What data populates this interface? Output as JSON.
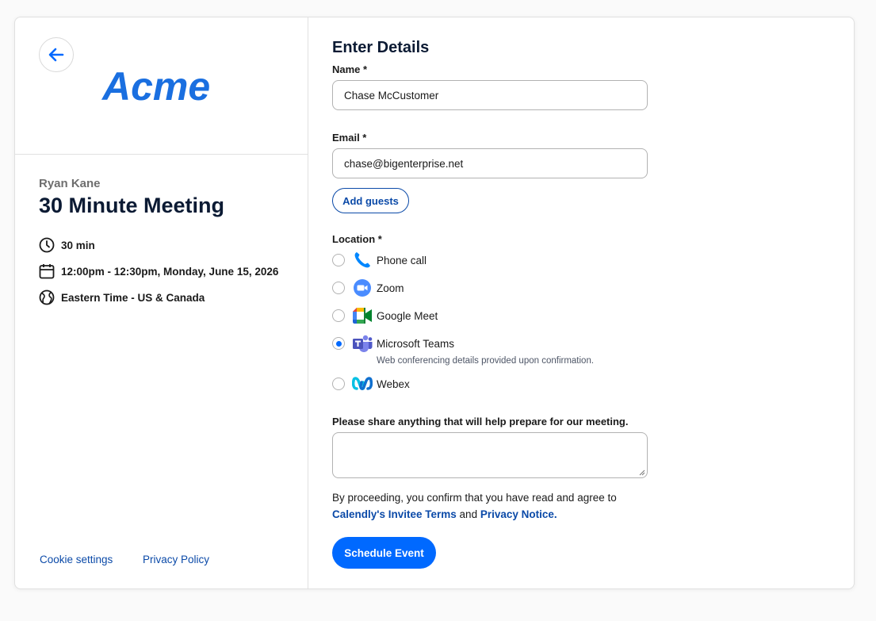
{
  "sidebar": {
    "logo_text": "Acme",
    "host_name": "Ryan Kane",
    "event_title": "30 Minute Meeting",
    "duration": "30 min",
    "datetime": "12:00pm - 12:30pm, Monday, June 15, 2026",
    "timezone": "Eastern Time - US & Canada",
    "footer_links": [
      "Cookie settings",
      "Privacy Policy"
    ]
  },
  "form": {
    "heading": "Enter Details",
    "name_label": "Name *",
    "name_value": "Chase McCustomer",
    "email_label": "Email *",
    "email_value": "chase@bigenterprise.net",
    "add_guests_label": "Add guests",
    "location_label": "Location *",
    "location_options": [
      {
        "label": "Phone call",
        "icon": "phone-icon",
        "selected": false
      },
      {
        "label": "Zoom",
        "icon": "zoom-icon",
        "selected": false
      },
      {
        "label": "Google Meet",
        "icon": "google-meet-icon",
        "selected": false
      },
      {
        "label": "Microsoft Teams",
        "icon": "microsoft-teams-icon",
        "selected": true
      },
      {
        "label": "Webex",
        "icon": "webex-icon",
        "selected": false
      }
    ],
    "teams_hint": "Web conferencing details provided upon confirmation.",
    "notes_label": "Please share anything that will help prepare for our meeting.",
    "notes_value": "",
    "consent_prefix": "By proceeding, you confirm that you have read and agree to",
    "consent_terms_link": "Calendly's Invitee Terms",
    "consent_and": "and",
    "consent_privacy_link": "Privacy Notice.",
    "submit_label": "Schedule Event"
  },
  "colors": {
    "accent": "#0069ff",
    "link": "#0b4aa8",
    "heading": "#0b1a33"
  }
}
